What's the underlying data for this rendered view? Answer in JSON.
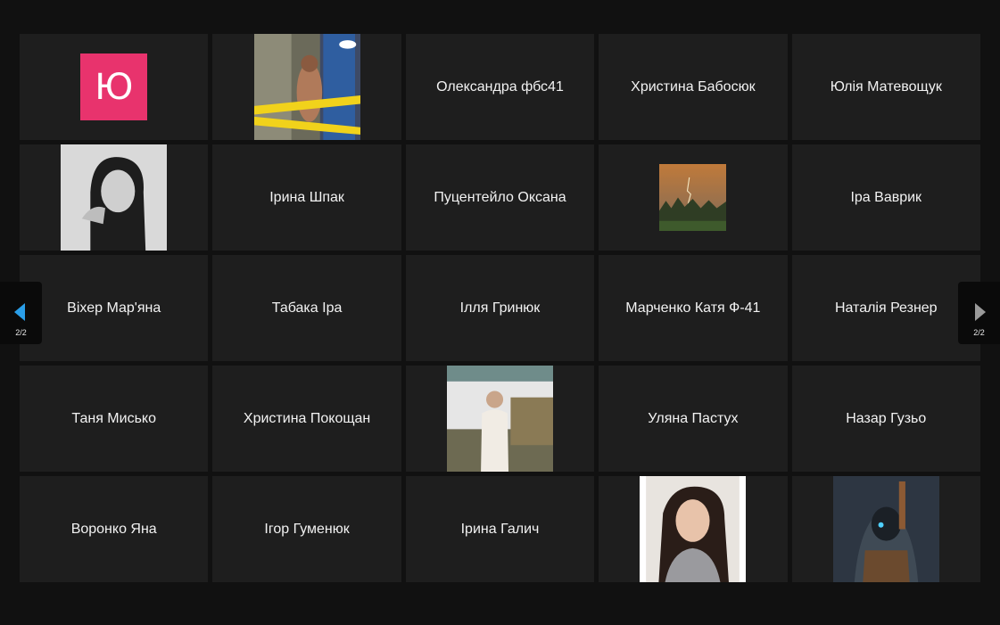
{
  "colors": {
    "background": "#111111",
    "tile": "#1e1e1e",
    "text": "#f2f2f2",
    "letter_avatar": "#e8336d",
    "prev_arrow": "#2a9ee8",
    "next_arrow": "#9a9a9a"
  },
  "pager": {
    "prev_count": "2/2",
    "next_count": "2/2"
  },
  "tiles": [
    {
      "type": "letter",
      "letter": "Ю"
    },
    {
      "type": "photo",
      "icon": "crime-tape-photo"
    },
    {
      "type": "name",
      "name": "Олександра фбс41"
    },
    {
      "type": "name",
      "name": "Христина Бабосюк"
    },
    {
      "type": "name",
      "name": "Юлія Матевощук"
    },
    {
      "type": "photo",
      "icon": "bw-portrait-photo"
    },
    {
      "type": "name",
      "name": "Ірина Шпак"
    },
    {
      "type": "name",
      "name": "Пуцентейло Оксана"
    },
    {
      "type": "photo",
      "icon": "landscape-photo"
    },
    {
      "type": "name",
      "name": "Іра Ваврик"
    },
    {
      "type": "name",
      "name": "Віхер Мар'яна"
    },
    {
      "type": "name",
      "name": "Табака Іра"
    },
    {
      "type": "name",
      "name": "Ілля Гринюк"
    },
    {
      "type": "name",
      "name": "Марченко Катя Ф-41"
    },
    {
      "type": "name",
      "name": "Наталія Резнер"
    },
    {
      "type": "name",
      "name": "Таня Мисько"
    },
    {
      "type": "name",
      "name": "Христина Покощан"
    },
    {
      "type": "photo",
      "icon": "outdoor-man-photo"
    },
    {
      "type": "name",
      "name": "Уляна Пастух"
    },
    {
      "type": "name",
      "name": "Назар Гузьо"
    },
    {
      "type": "name",
      "name": "Воронко Яна"
    },
    {
      "type": "name",
      "name": "Ігор Гуменюк"
    },
    {
      "type": "name",
      "name": "Ірина Галич"
    },
    {
      "type": "photo",
      "icon": "selfie-portrait-photo"
    },
    {
      "type": "photo",
      "icon": "game-character-photo"
    }
  ]
}
